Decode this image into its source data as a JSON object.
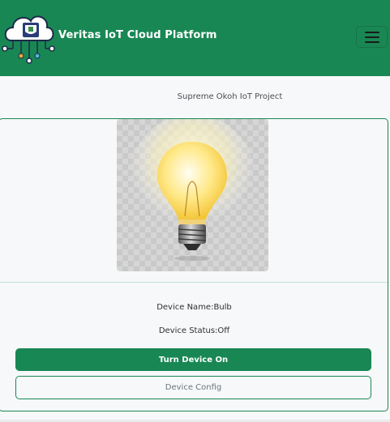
{
  "navbar": {
    "brand_title": "Veritas IoT Cloud Platform",
    "logo_icon": "cloud-circuit-logo-icon",
    "menu_icon": "hamburger-menu-icon",
    "brand_color": "#198754"
  },
  "project": {
    "title": "Supreme Okoh IoT Project"
  },
  "device": {
    "image_icon": "light-bulb-icon",
    "name_text": "Device Name:Bulb",
    "status_text": "Device Status:Off",
    "turn_on_label": "Turn Device On",
    "config_label": "Device Config"
  }
}
